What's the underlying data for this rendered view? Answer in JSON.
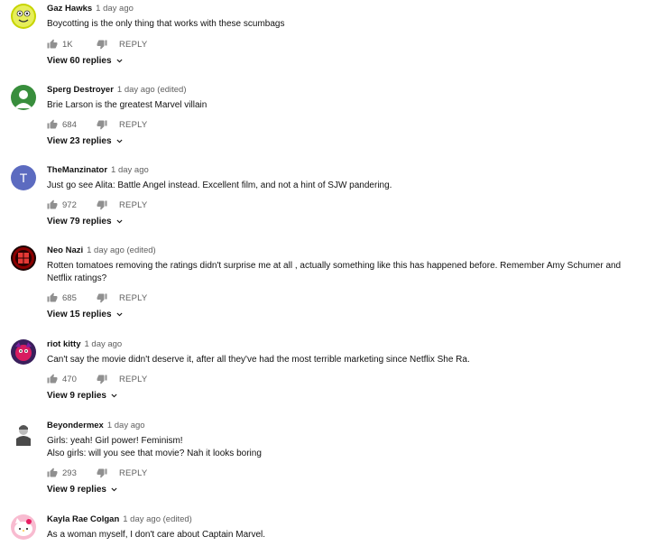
{
  "icons": {
    "like": "thumbs-up-icon",
    "dislike": "thumbs-down-icon",
    "expand": "chevron-down-icon"
  },
  "colors": {
    "text": "#111111",
    "meta": "#606060",
    "avatar_green": "#388e3c",
    "avatar_blue": "#5c6bc0"
  },
  "comments": [
    {
      "author": "Gaz Hawks",
      "time": "1 day ago",
      "lines": [
        "Boycotting is the only thing that works with these scumbags"
      ],
      "likes": "1K",
      "reply_label": "REPLY",
      "view_replies": "View 60 replies"
    },
    {
      "author": "Sperg Destroyer",
      "time": "1 day ago (edited)",
      "lines": [
        "Brie Larson is the greatest Marvel villain"
      ],
      "likes": "684",
      "reply_label": "REPLY",
      "view_replies": "View 23 replies"
    },
    {
      "author": "TheManzinator",
      "time": "1 day ago",
      "avatar_letter": "T",
      "lines": [
        "Just go see Alita: Battle Angel instead. Excellent film, and not a hint of SJW pandering."
      ],
      "likes": "972",
      "reply_label": "REPLY",
      "view_replies": "View 79 replies"
    },
    {
      "author": "Neo Nazi",
      "time": "1 day ago (edited)",
      "lines": [
        "Rotten tomatoes removing the ratings didn't surprise me at all , actually something like this has happened before. Remember Amy Schumer and",
        "Netflix ratings?"
      ],
      "likes": "685",
      "reply_label": "REPLY",
      "view_replies": "View 15 replies"
    },
    {
      "author": "riot kitty",
      "time": "1 day ago",
      "lines": [
        "Can't say the movie didn't deserve it, after all they've had the most terrible marketing since Netflix She Ra."
      ],
      "likes": "470",
      "reply_label": "REPLY",
      "view_replies": "View 9 replies"
    },
    {
      "author": "Beyondermex",
      "time": "1 day ago",
      "lines": [
        "Girls: yeah! Girl power! Feminism!",
        "Also girls: will you see that movie? Nah it looks boring"
      ],
      "likes": "293",
      "reply_label": "REPLY",
      "view_replies": "View 9 replies"
    },
    {
      "author": "Kayla Rae Colgan",
      "time": "1 day ago (edited)",
      "lines": [
        "As a woman myself, I don't care about Captain Marvel."
      ]
    }
  ]
}
